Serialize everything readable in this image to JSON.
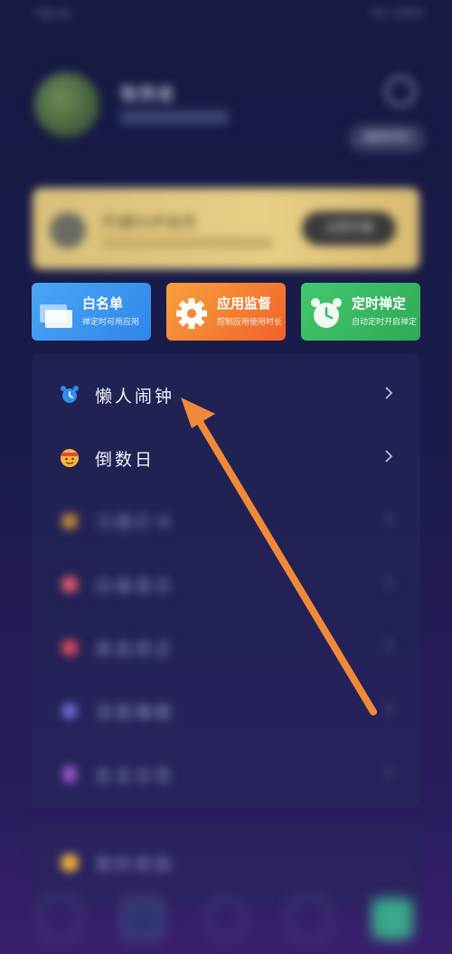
{
  "status_bar": {
    "time": "08:41",
    "right": "5G 100%"
  },
  "profile": {
    "username": "敬畏者",
    "edit_label": "编辑资料"
  },
  "vip": {
    "title": "开通SVIP会员",
    "button": "立即开通"
  },
  "cards": [
    {
      "title": "白名单",
      "subtitle": "禅定时可用应用",
      "icon": "windows-icon"
    },
    {
      "title": "应用监督",
      "subtitle": "控制应用使用时长",
      "icon": "gear-icon"
    },
    {
      "title": "定时禅定",
      "subtitle": "自动定时开启禅定",
      "icon": "alarm-clock-icon"
    }
  ],
  "list": {
    "items": [
      {
        "label": "懒人闹钟",
        "icon": "alarm-icon",
        "color": "#2f8cf0"
      },
      {
        "label": "倒数日",
        "icon": "emoji-icon",
        "color": "#f2b63a"
      },
      {
        "label": "习惯打卡",
        "icon": "checkin-icon",
        "color": "#c98a3a"
      },
      {
        "label": "白噪音乐",
        "icon": "music-icon",
        "color": "#e85b6a"
      },
      {
        "label": "体态矫正",
        "icon": "posture-icon",
        "color": "#e24a5a"
      },
      {
        "label": "深度睡眠",
        "icon": "moon-icon",
        "color": "#6a6ad0"
      },
      {
        "label": "名言日签",
        "icon": "note-icon",
        "color": "#9a5ad0"
      }
    ]
  },
  "extra": {
    "label": "我的奖励",
    "icon": "coin-icon",
    "color": "#f0b43a"
  },
  "colors": {
    "arrow": "#f08a3a",
    "background": "#1a1b4a"
  }
}
